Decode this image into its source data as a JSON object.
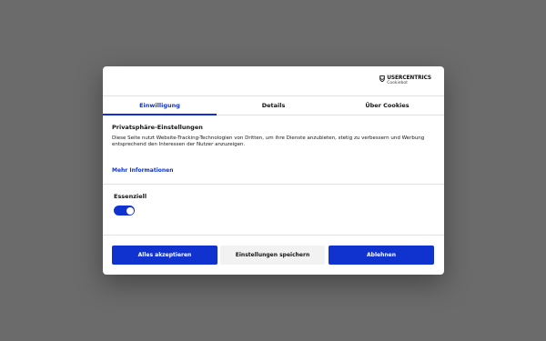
{
  "brand": {
    "logo_main": "USERCENTRICS",
    "logo_sub": "Cookiebot"
  },
  "tabs": [
    {
      "label": "Einwilligung",
      "active": true
    },
    {
      "label": "Details",
      "active": false
    },
    {
      "label": "Über Cookies",
      "active": false
    }
  ],
  "content": {
    "title": "Privatsphäre-Einstellungen",
    "description": "Diese Seite nutzt Website-Tracking-Technologien von Dritten, um ihre Dienste anzubieten, stetig zu verbessern und Werbung entsprechend den Interessen der Nutzer anzuzeigen.",
    "more_link": "Mehr Informationen"
  },
  "category": {
    "label": "Essenziell",
    "toggle_on": true
  },
  "buttons": {
    "accept_all": "Alles akzeptieren",
    "save_settings": "Einstellungen speichern",
    "deny": "Ablehnen"
  },
  "colors": {
    "accent": "#1032cf",
    "overlay": "#6b6b6b",
    "secondary_button": "#f2f2f2"
  }
}
